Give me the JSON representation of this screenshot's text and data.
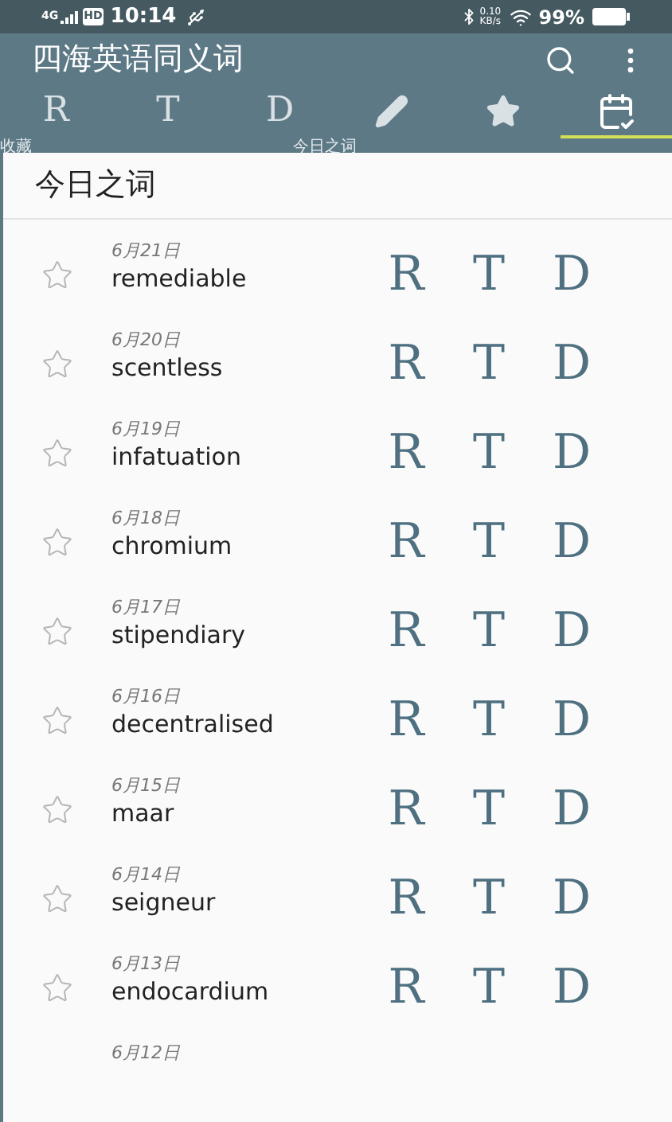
{
  "status_bar": {
    "network": "4G",
    "hd": "HD",
    "time": "10:14",
    "speed": "0.10 KB/s",
    "battery": "99%"
  },
  "app_bar": {
    "title": "四海英语同义词"
  },
  "tabs": [
    {
      "kind": "letter",
      "label": "R",
      "selected": false
    },
    {
      "kind": "letter",
      "label": "T",
      "selected": false
    },
    {
      "kind": "letter",
      "label": "D",
      "selected": false
    },
    {
      "kind": "pencil",
      "selected": false
    },
    {
      "kind": "star",
      "selected": false
    },
    {
      "kind": "calendar",
      "selected": true
    }
  ],
  "tab_labels": [
    "收藏",
    "今日之词"
  ],
  "card": {
    "title": "今日之词"
  },
  "words": [
    {
      "date": "6月21日",
      "word": "remediable",
      "starred": false,
      "links": [
        "R",
        "T",
        "D"
      ]
    },
    {
      "date": "6月20日",
      "word": "scentless",
      "starred": false,
      "links": [
        "R",
        "T",
        "D"
      ]
    },
    {
      "date": "6月19日",
      "word": "infatuation",
      "starred": false,
      "links": [
        "R",
        "T",
        "D"
      ]
    },
    {
      "date": "6月18日",
      "word": "chromium",
      "starred": false,
      "links": [
        "R",
        "T",
        "D"
      ]
    },
    {
      "date": "6月17日",
      "word": "stipendiary",
      "starred": false,
      "links": [
        "R",
        "T",
        "D"
      ]
    },
    {
      "date": "6月16日",
      "word": "decentralised",
      "starred": false,
      "links": [
        "R",
        "T",
        "D"
      ]
    },
    {
      "date": "6月15日",
      "word": "maar",
      "starred": false,
      "links": [
        "R",
        "T",
        "D"
      ]
    },
    {
      "date": "6月14日",
      "word": "seigneur",
      "starred": false,
      "links": [
        "R",
        "T",
        "D"
      ]
    },
    {
      "date": "6月13日",
      "word": "endocardium",
      "starred": false,
      "links": [
        "R",
        "T",
        "D"
      ]
    },
    {
      "date": "6月12日"
    }
  ]
}
